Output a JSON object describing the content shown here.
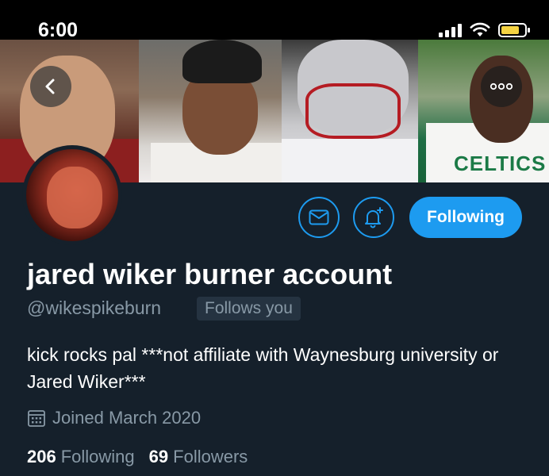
{
  "status_bar": {
    "time": "6:00"
  },
  "banner": {
    "jersey_text": "CELTICS"
  },
  "profile": {
    "display_name": "jared wiker burner account",
    "handle": "@wikespikeburn",
    "follows_you_badge": "Follows you",
    "bio": "kick rocks pal ***not affiliate with Waynesburg university or Jared Wiker***",
    "joined": "Joined March 2020"
  },
  "actions": {
    "following_label": "Following"
  },
  "stats": {
    "following_count": "206",
    "following_label": "Following",
    "followers_count": "69",
    "followers_label": "Followers"
  },
  "colors": {
    "background": "#15202b",
    "accent": "#1d9bf0",
    "secondary_text": "#8899a6",
    "battery": "#f5d343"
  }
}
